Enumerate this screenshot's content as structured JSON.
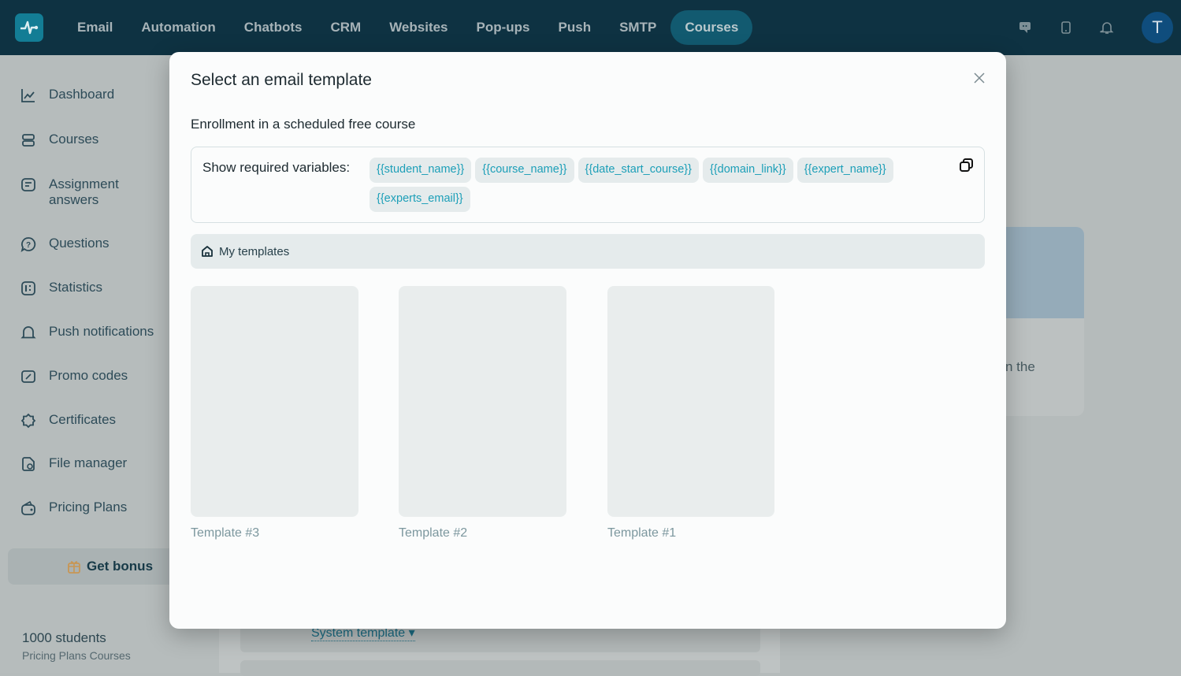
{
  "topbar": {
    "nav": [
      "Email",
      "Automation",
      "Chatbots",
      "CRM",
      "Websites",
      "Pop-ups",
      "Push",
      "SMTP",
      "Courses"
    ],
    "active": "Courses",
    "avatar_letter": "T"
  },
  "sidebar": {
    "items": [
      "Dashboard",
      "Courses",
      "Assignment answers",
      "Questions",
      "Statistics",
      "Push notifications",
      "Promo codes",
      "Certificates",
      "File manager",
      "Pricing Plans"
    ],
    "bonus": "Get bonus",
    "plan_title": "1000 students",
    "plan_subtitle": "Pricing Plans Courses"
  },
  "background": {
    "system_template": "System template",
    "card_text": "n the"
  },
  "modal": {
    "title": "Select an email template",
    "subtitle": "Enrollment in a scheduled free course",
    "variables_label": "Show required variables:",
    "variables": [
      "{{student_name}}",
      "{{course_name}}",
      "{{date_start_course}}",
      "{{domain_link}}",
      "{{expert_name}}",
      "{{experts_email}}"
    ],
    "folder": "My templates",
    "templates": [
      "Template #3",
      "Template #2",
      "Template #1"
    ]
  },
  "colors": {
    "topbar": "#0e3242",
    "accent": "#1c9fb8",
    "active_nav": "#125a70"
  }
}
